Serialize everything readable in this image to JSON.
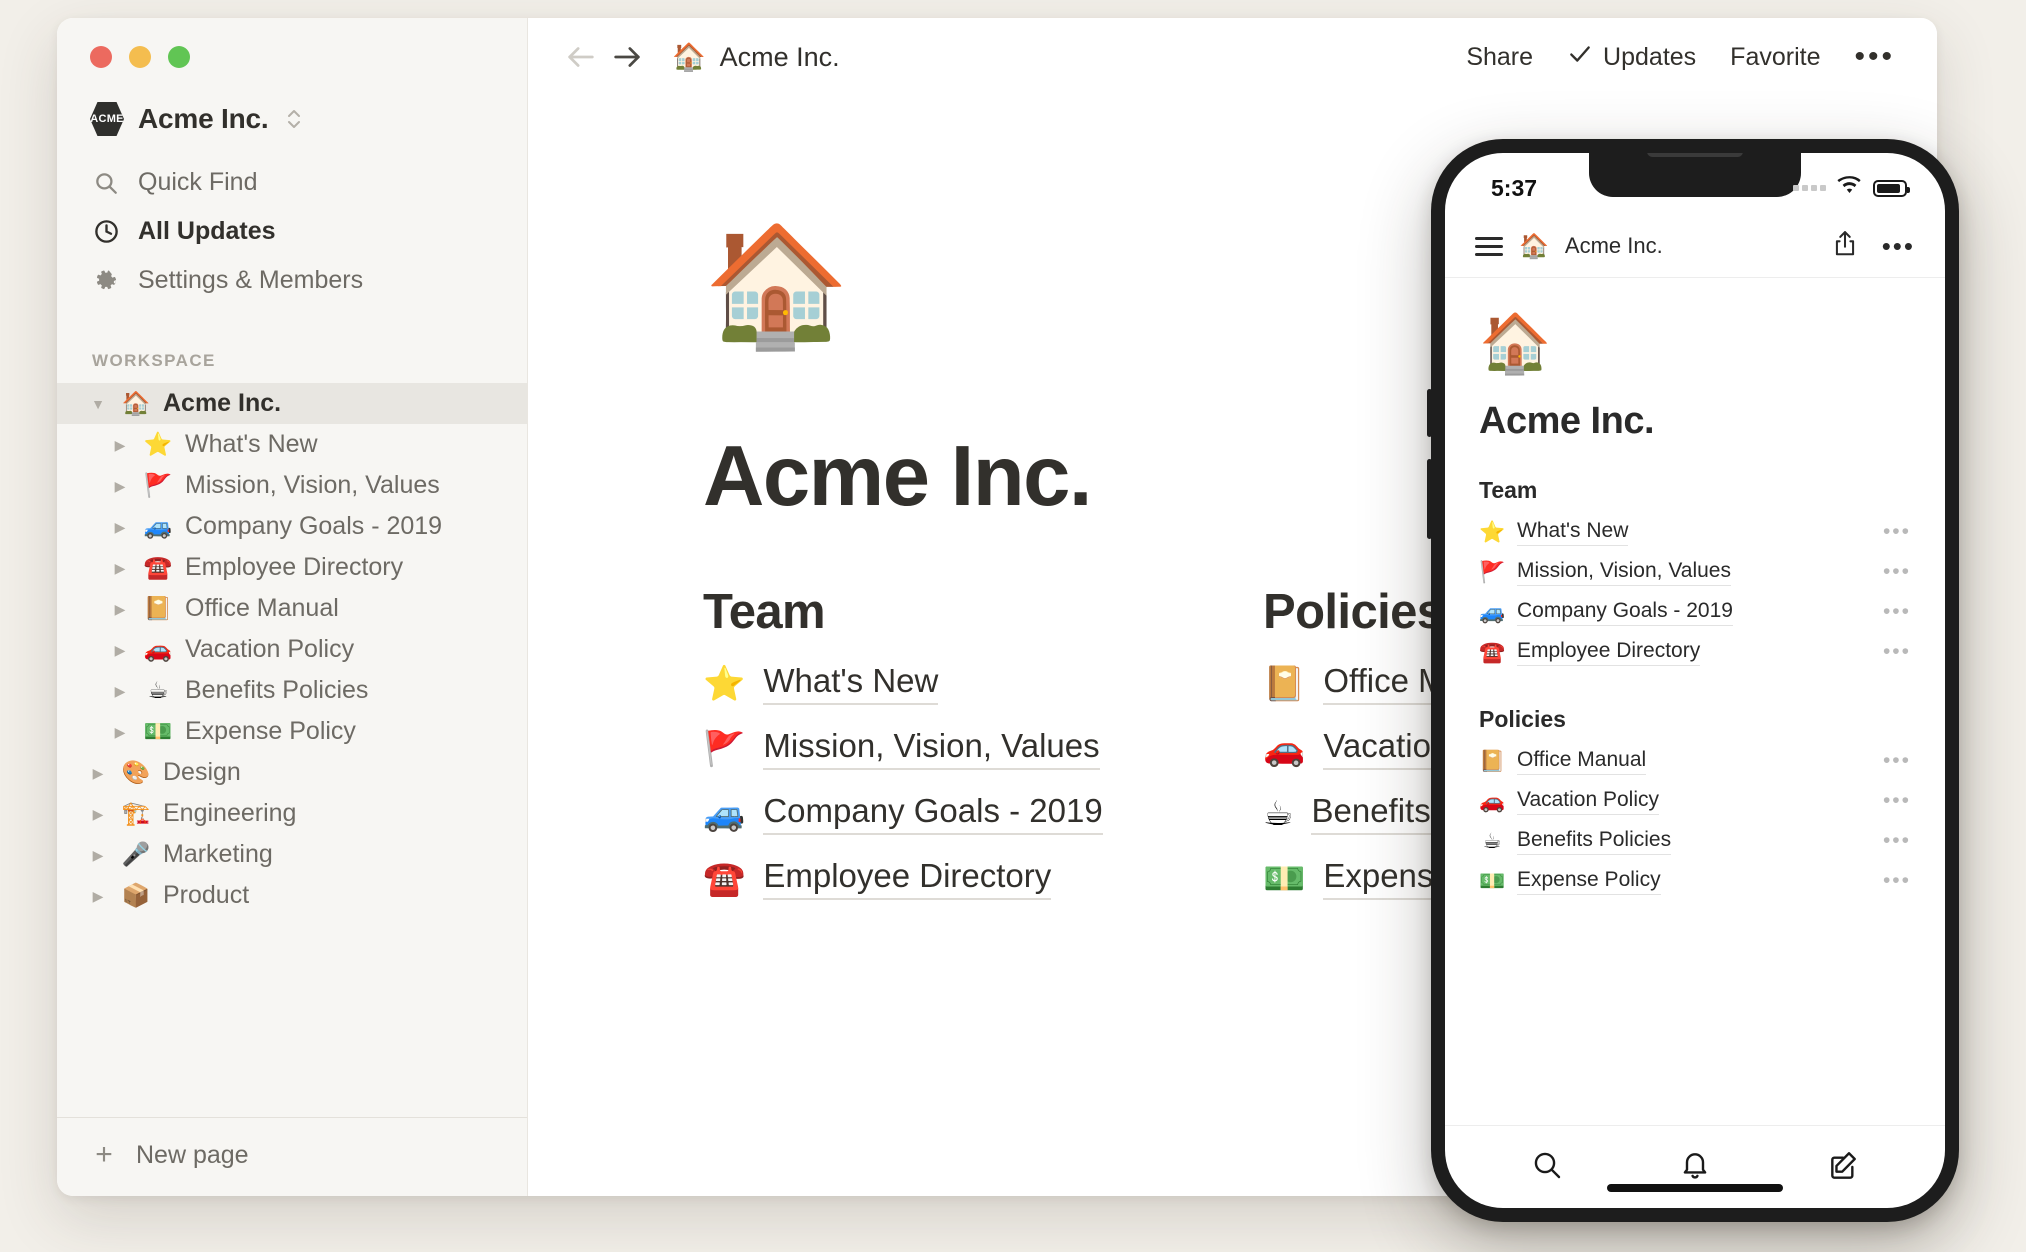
{
  "window": {
    "traffic_lights": [
      "close",
      "minimize",
      "zoom"
    ]
  },
  "sidebar": {
    "workspace_switcher": {
      "logo_text": "ACME",
      "name": "Acme Inc."
    },
    "nav_items": [
      {
        "label": "Quick Find",
        "icon": "search-icon"
      },
      {
        "label": "All Updates",
        "icon": "clock-icon"
      },
      {
        "label": "Settings & Members",
        "icon": "gear-icon"
      }
    ],
    "section_header": "WORKSPACE",
    "tree": [
      {
        "label": "Acme Inc.",
        "emoji": "🏠",
        "depth": 0,
        "expanded": true,
        "selected": true
      },
      {
        "label": "What's New",
        "emoji": "⭐",
        "depth": 1,
        "expanded": false,
        "selected": false
      },
      {
        "label": "Mission, Vision, Values",
        "emoji": "🚩",
        "depth": 1,
        "expanded": false,
        "selected": false
      },
      {
        "label": "Company Goals - 2019",
        "emoji": "🚙",
        "depth": 1,
        "expanded": false,
        "selected": false
      },
      {
        "label": "Employee Directory",
        "emoji": "☎️",
        "depth": 1,
        "expanded": false,
        "selected": false
      },
      {
        "label": "Office Manual",
        "emoji": "📔",
        "depth": 1,
        "expanded": false,
        "selected": false
      },
      {
        "label": "Vacation Policy",
        "emoji": "🚗",
        "depth": 1,
        "expanded": false,
        "selected": false
      },
      {
        "label": "Benefits Policies",
        "emoji": "☕",
        "depth": 1,
        "expanded": false,
        "selected": false
      },
      {
        "label": "Expense Policy",
        "emoji": "💵",
        "depth": 1,
        "expanded": false,
        "selected": false
      },
      {
        "label": "Design",
        "emoji": "🎨",
        "depth": 0,
        "expanded": false,
        "selected": false
      },
      {
        "label": "Engineering",
        "emoji": "🏗️",
        "depth": 0,
        "expanded": false,
        "selected": false
      },
      {
        "label": "Marketing",
        "emoji": "🎤",
        "depth": 0,
        "expanded": false,
        "selected": false
      },
      {
        "label": "Product",
        "emoji": "📦",
        "depth": 0,
        "expanded": false,
        "selected": false
      }
    ],
    "footer": {
      "label": "New page",
      "icon": "plus-icon"
    }
  },
  "topbar": {
    "back_icon": "arrow-left-icon",
    "forward_icon": "arrow-right-icon",
    "breadcrumb": {
      "emoji": "🏠",
      "label": "Acme Inc."
    },
    "share_label": "Share",
    "updates_label": "Updates",
    "updates_icon": "check-icon",
    "favorite_label": "Favorite",
    "more_label": "•••"
  },
  "page": {
    "hero_emoji": "🏠",
    "title": "Acme Inc.",
    "columns": [
      {
        "heading": "Team",
        "links": [
          {
            "emoji": "⭐",
            "label": "What's New"
          },
          {
            "emoji": "🚩",
            "label": "Mission, Vision, Values"
          },
          {
            "emoji": "🚙",
            "label": "Company Goals - 2019"
          },
          {
            "emoji": "☎️",
            "label": "Employee Directory"
          }
        ]
      },
      {
        "heading": "Policies",
        "links": [
          {
            "emoji": "📔",
            "label": "Office Manual"
          },
          {
            "emoji": "🚗",
            "label": "Vacation Policy"
          },
          {
            "emoji": "☕",
            "label": "Benefits Policies"
          },
          {
            "emoji": "💵",
            "label": "Expense Policy"
          }
        ]
      }
    ]
  },
  "phone": {
    "status": {
      "time": "5:37",
      "wifi_icon": "wifi-icon",
      "battery_icon": "battery-icon"
    },
    "header": {
      "menu_icon": "hamburger-icon",
      "emoji": "🏠",
      "title": "Acme Inc.",
      "share_icon": "share-icon",
      "more_label": "•••"
    },
    "content": {
      "hero_emoji": "🏠",
      "title": "Acme Inc.",
      "sections": [
        {
          "heading": "Team",
          "rows": [
            {
              "emoji": "⭐",
              "label": "What's New",
              "menu": "•••"
            },
            {
              "emoji": "🚩",
              "label": "Mission, Vision, Values",
              "menu": "•••"
            },
            {
              "emoji": "🚙",
              "label": "Company Goals - 2019",
              "menu": "•••"
            },
            {
              "emoji": "☎️",
              "label": "Employee Directory",
              "menu": "•••"
            }
          ]
        },
        {
          "heading": "Policies",
          "rows": [
            {
              "emoji": "📔",
              "label": "Office Manual",
              "menu": "•••"
            },
            {
              "emoji": "🚗",
              "label": "Vacation Policy",
              "menu": "•••"
            },
            {
              "emoji": "☕",
              "label": "Benefits Policies",
              "menu": "•••"
            },
            {
              "emoji": "💵",
              "label": "Expense Policy",
              "menu": "•••"
            }
          ]
        }
      ]
    },
    "tabbar": [
      {
        "icon": "search-icon"
      },
      {
        "icon": "bell-icon"
      },
      {
        "icon": "compose-icon"
      }
    ]
  },
  "colors": {
    "page_background": "#f2efe9",
    "sidebar_background": "#f7f6f3",
    "surface": "#ffffff",
    "text_primary": "#32302c",
    "text_secondary": "#6d6a64",
    "selected_row": "#e8e6e1",
    "traffic_red": "#ec6a5f",
    "traffic_yellow": "#f4bd4f",
    "traffic_green": "#61c554"
  }
}
